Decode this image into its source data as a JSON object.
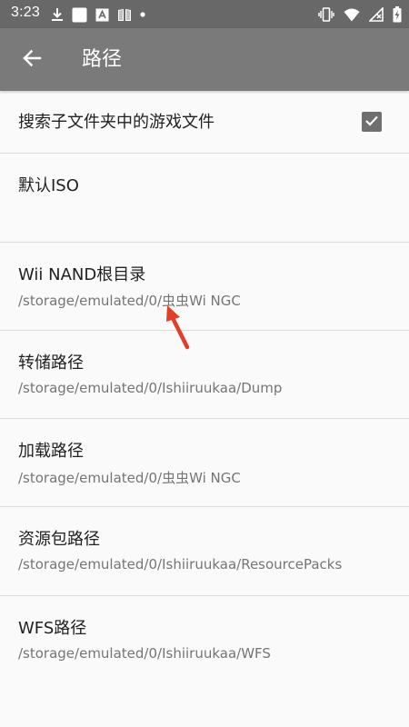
{
  "status_bar": {
    "time": "3:23",
    "left_icons": [
      "download-icon",
      "app-icon",
      "translate-icon",
      "book-icon",
      "dot-icon"
    ],
    "right_icons": [
      "vibrate-icon",
      "wifi-icon",
      "no-signal-icon",
      "battery-charging-icon"
    ]
  },
  "toolbar": {
    "back_icon": "arrow-back-icon",
    "title": "路径"
  },
  "settings": [
    {
      "title": "搜索子文件夹中的游戏文件",
      "summary": "",
      "checked": true
    },
    {
      "title": "默认ISO",
      "summary": ""
    },
    {
      "title": "Wii NAND根目录",
      "summary": "/storage/emulated/0/虫虫Wi NGC"
    },
    {
      "title": "转储路径",
      "summary": "/storage/emulated/0/Ishiiruukaa/Dump"
    },
    {
      "title": "加载路径",
      "summary": "/storage/emulated/0/虫虫Wi NGC"
    },
    {
      "title": "资源包路径",
      "summary": "/storage/emulated/0/Ishiiruukaa/ResourcePacks"
    },
    {
      "title": "WFS路径",
      "summary": "/storage/emulated/0/Ishiiruukaa/WFS"
    }
  ],
  "colors": {
    "status_bar": "#686868",
    "toolbar": "#7a7a7a",
    "background": "#fafafa",
    "divider": "#dcdcdc",
    "annotation_arrow": "#e0402a"
  }
}
